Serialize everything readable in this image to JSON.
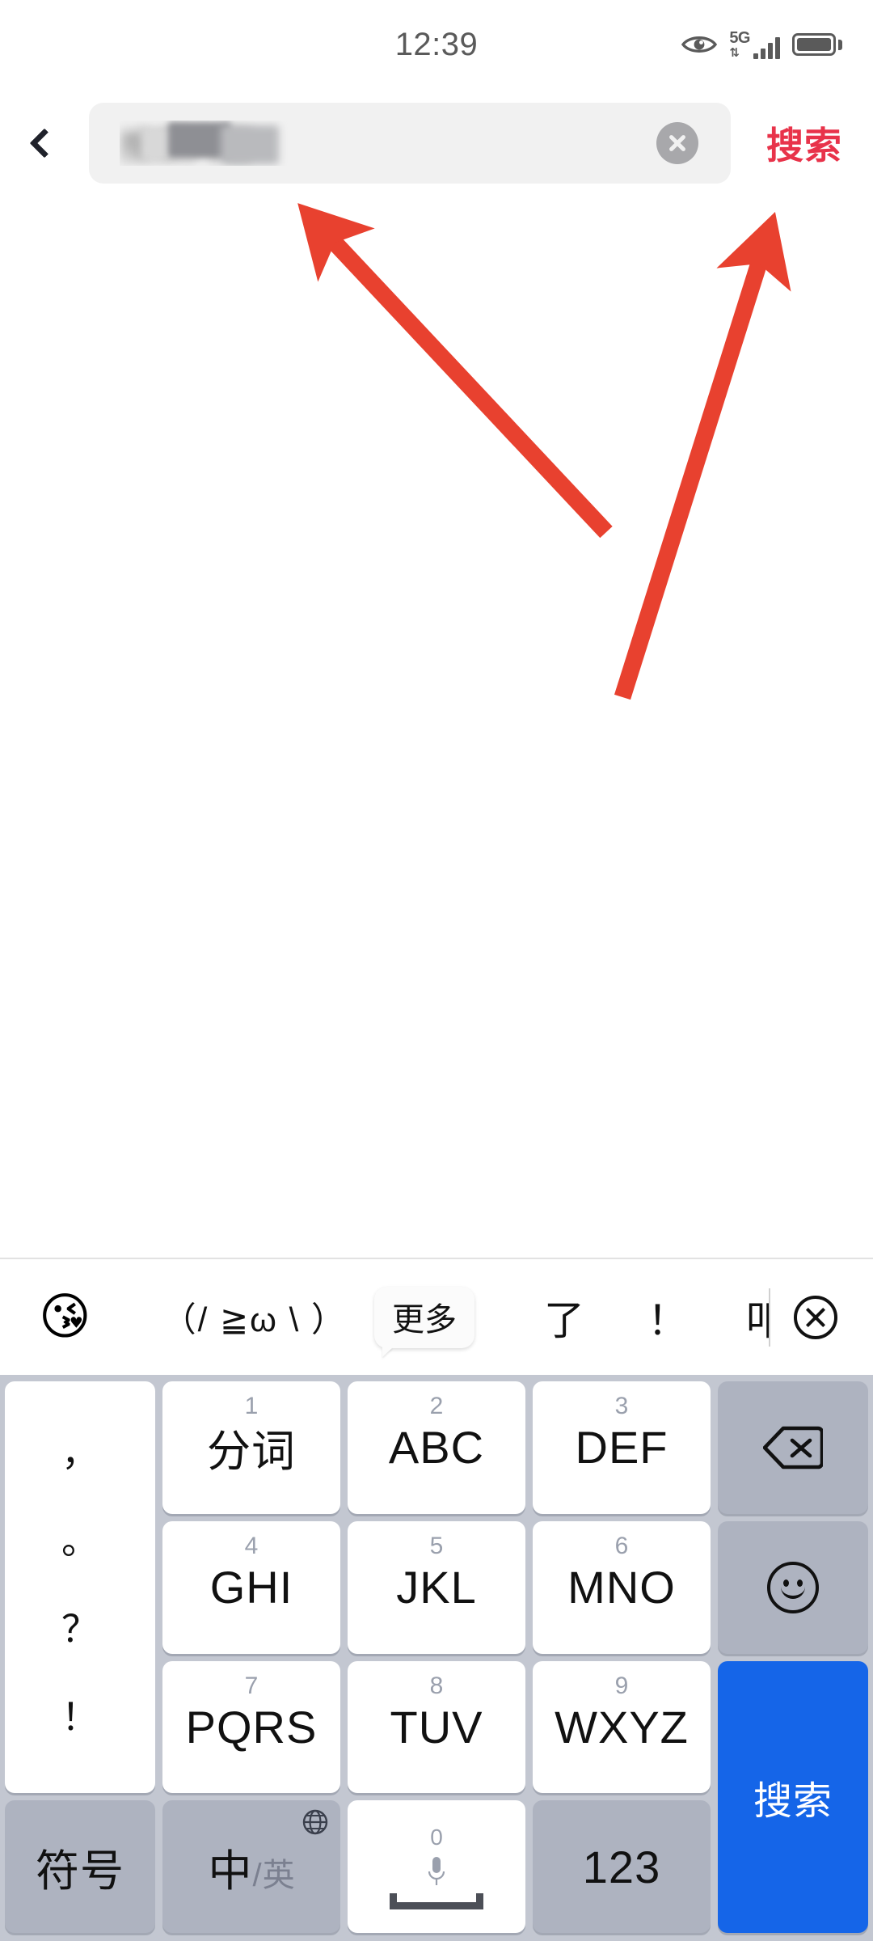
{
  "status_bar": {
    "time": "12:39",
    "icons": [
      "eye-icon",
      "5g-signal-icon",
      "battery-icon"
    ],
    "network_label": "5G",
    "network_arrows": "⇅"
  },
  "search_header": {
    "back_icon": "chevron-left-icon",
    "input_value": "搜索内容",
    "input_redacted": true,
    "clear_icon": "clear-circle-icon",
    "action_label": "搜索",
    "action_color": "#e8334a"
  },
  "annotations": {
    "arrow_color": "#e8412f",
    "arrows": [
      {
        "name": "arrow-to-search-input",
        "points_to": "search-input"
      },
      {
        "name": "arrow-to-search-button",
        "points_to": "search-action-button"
      }
    ]
  },
  "keyboard": {
    "candidate_bar": {
      "emoji": "😘",
      "kaomoji": "（/ ≧ω \\ ）",
      "more_label": "更多",
      "candidates": [
        "了",
        "！",
        "叩"
      ],
      "close_icon": "close-circle-icon"
    },
    "punctuation_key": {
      "name": "punctuation-key",
      "marks": [
        "，",
        "。",
        "？",
        "！"
      ]
    },
    "rows": [
      [
        {
          "name": "key-1",
          "num": "1",
          "label": "分词",
          "style": "white"
        },
        {
          "name": "key-2",
          "num": "2",
          "label": "ABC",
          "style": "white"
        },
        {
          "name": "key-3",
          "num": "3",
          "label": "DEF",
          "style": "white"
        },
        {
          "name": "backspace-key",
          "label": "",
          "icon": "backspace-icon",
          "style": "gray"
        }
      ],
      [
        {
          "name": "key-4",
          "num": "4",
          "label": "GHI",
          "style": "white"
        },
        {
          "name": "key-5",
          "num": "5",
          "label": "JKL",
          "style": "white"
        },
        {
          "name": "key-6",
          "num": "6",
          "label": "MNO",
          "style": "white"
        },
        {
          "name": "emoji-key",
          "label": "",
          "icon": "smiley-icon",
          "style": "gray"
        }
      ],
      [
        {
          "name": "key-7",
          "num": "7",
          "label": "PQRS",
          "style": "white"
        },
        {
          "name": "key-8",
          "num": "8",
          "label": "TUV",
          "style": "white"
        },
        {
          "name": "key-9",
          "num": "9",
          "label": "WXYZ",
          "style": "white"
        },
        {
          "name": "search-key",
          "label": "搜索",
          "style": "blue"
        }
      ],
      [
        {
          "name": "symbol-key",
          "label": "符号",
          "style": "gray"
        },
        {
          "name": "language-toggle-key",
          "label_zh": "中",
          "label_sep": "/",
          "label_en": "英",
          "icon": "globe-icon",
          "style": "gray"
        },
        {
          "name": "space-key",
          "num": "0",
          "icon": "microphone-icon",
          "style": "white"
        },
        {
          "name": "numeric-key",
          "label": "123",
          "style": "gray"
        }
      ]
    ]
  },
  "colors": {
    "keyboard_bg": "#c3c7d1",
    "key_gray": "#aeb3c0",
    "key_blue": "#1565e8",
    "accent_red": "#e8334a",
    "arrow_red": "#e8412f"
  }
}
